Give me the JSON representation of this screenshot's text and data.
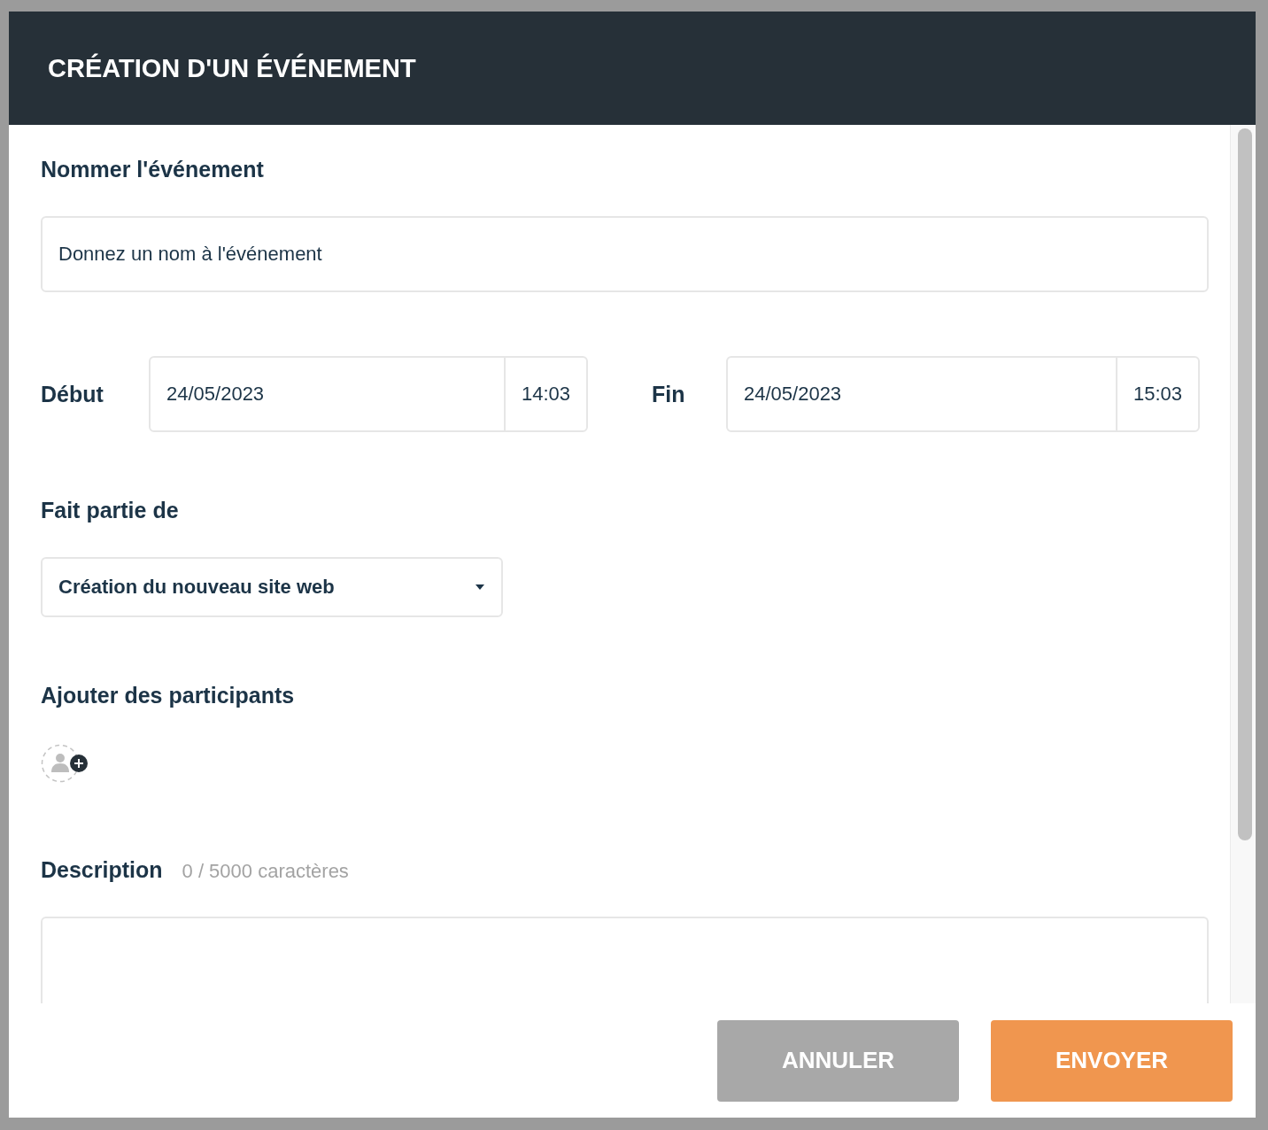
{
  "dialog": {
    "title": "CRÉATION D'UN ÉVÉNEMENT"
  },
  "name_field": {
    "label": "Nommer l'événement",
    "placeholder": "Donnez un nom à l'événement"
  },
  "start": {
    "label": "Début",
    "date": "24/05/2023",
    "time": "14:03"
  },
  "end": {
    "label": "Fin",
    "date": "24/05/2023",
    "time": "15:03"
  },
  "parent": {
    "label": "Fait partie de",
    "value": "Création du nouveau site web"
  },
  "participants": {
    "label": "Ajouter des participants"
  },
  "description": {
    "label": "Description",
    "counter": "0 / 5000 caractères"
  },
  "buttons": [
    {
      "label": "ANNULER",
      "kind": "secondary"
    },
    {
      "label": "ENVOYER",
      "kind": "primary"
    }
  ]
}
